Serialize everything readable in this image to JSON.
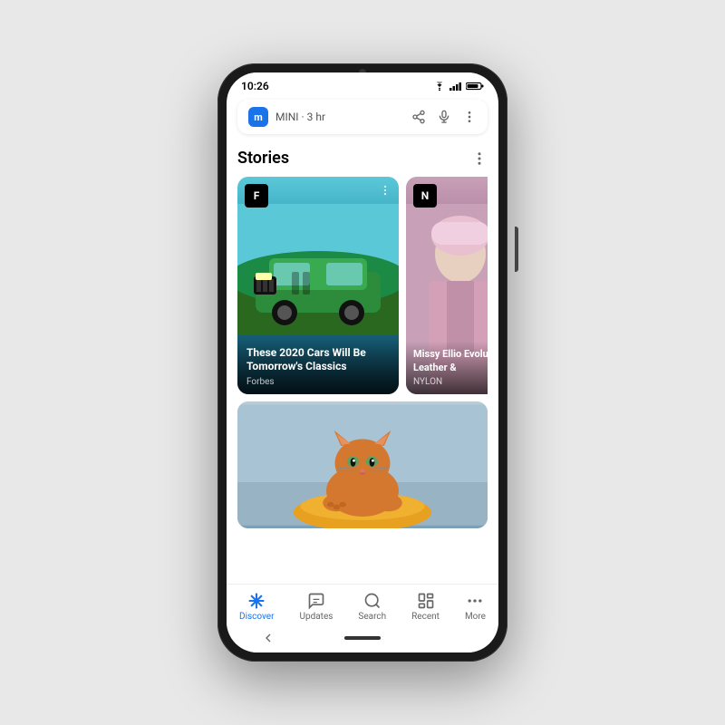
{
  "phone": {
    "status_bar": {
      "time": "10:26"
    },
    "notification": {
      "app_letter": "m",
      "app_name": "MINI",
      "time_ago": "3 hr"
    },
    "stories": {
      "title": "Stories",
      "card1": {
        "source_letter": "F",
        "headline": "These 2020 Cars Will Be Tomorrow's Classics",
        "source": "Forbes"
      },
      "card2": {
        "source_letter": "N",
        "headline": "Missy Ellio Evolution Leather &",
        "source": "NYLON"
      }
    },
    "bottom_nav": {
      "items": [
        {
          "id": "discover",
          "label": "Discover",
          "active": true
        },
        {
          "id": "updates",
          "label": "Updates",
          "active": false
        },
        {
          "id": "search",
          "label": "Search",
          "active": false
        },
        {
          "id": "recent",
          "label": "Recent",
          "active": false
        },
        {
          "id": "more",
          "label": "More",
          "active": false
        }
      ]
    }
  }
}
